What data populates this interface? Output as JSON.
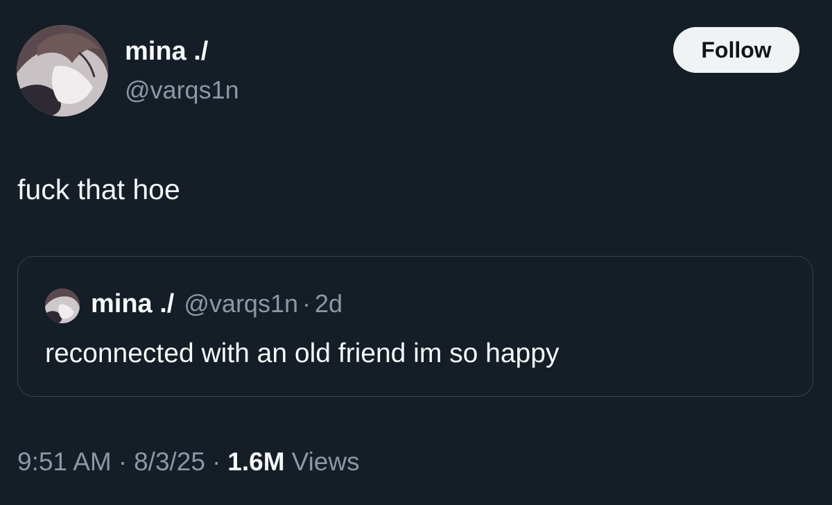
{
  "author": {
    "display_name": "mina ./",
    "handle": "@varqs1n"
  },
  "follow_button": {
    "label": "Follow"
  },
  "tweet": {
    "text": "fuck that hoe"
  },
  "quote": {
    "display_name": "mina ./",
    "handle": "@varqs1n",
    "separator": "·",
    "time": "2d",
    "text": "reconnected with an old friend im so happy"
  },
  "meta": {
    "time": "9:51 AM",
    "date": "8/3/25",
    "separator": "·",
    "views_count": "1.6M",
    "views_label": "Views"
  },
  "colors": {
    "background": "#151d27",
    "text_primary": "#f7f9f9",
    "text_secondary": "#8b98a5",
    "border": "#38444d",
    "follow_bg": "#eff3f4"
  },
  "icons": {
    "avatar": "profile-avatar-image"
  }
}
